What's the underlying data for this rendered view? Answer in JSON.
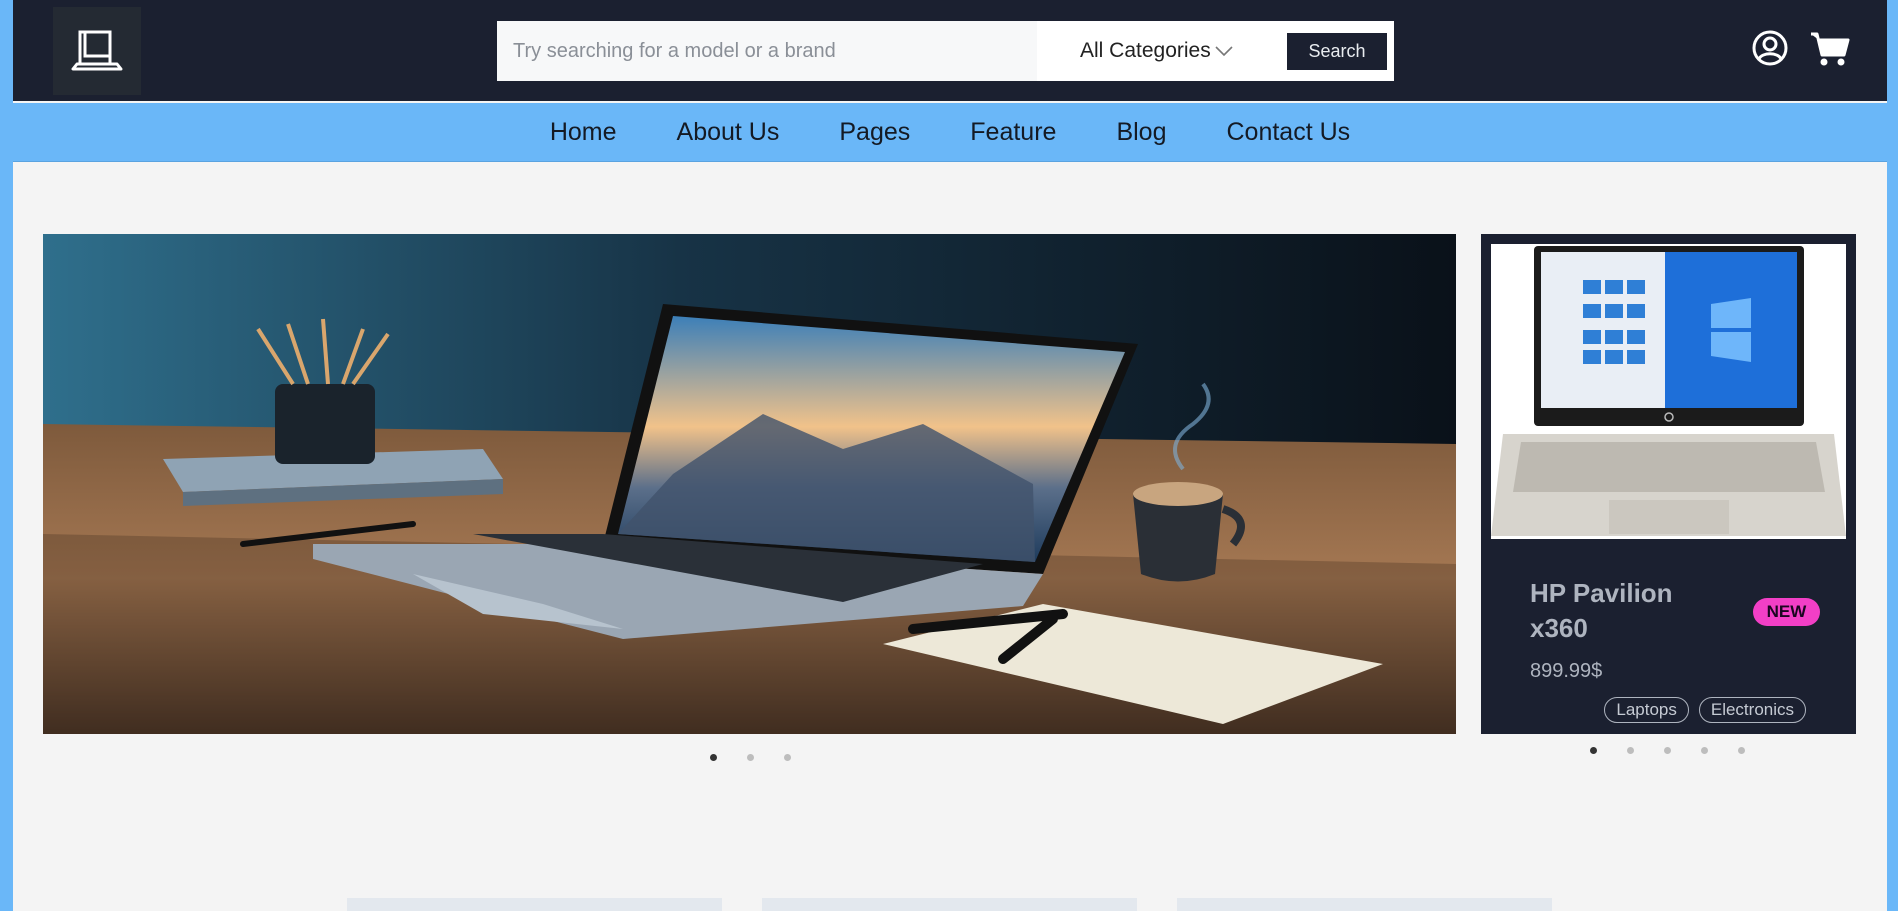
{
  "header": {
    "search_placeholder": "Try searching for a model or a brand",
    "category_selected": "All Categories",
    "search_button": "Search"
  },
  "nav": {
    "items": [
      "Home",
      "About Us",
      "Pages",
      "Feature",
      "Blog",
      "Contact Us"
    ]
  },
  "hero": {
    "slides_total": 3,
    "active_slide": 1
  },
  "product": {
    "name": "HP Pavilion x360",
    "badge": "NEW",
    "price": "899.99$",
    "tags": [
      "Laptops",
      "Electronics"
    ],
    "slides_total": 5,
    "active_slide": 1
  },
  "colors": {
    "header_bg": "#1b2030",
    "nav_bg": "#6ab7f8",
    "badge_bg": "#f23fc6",
    "page_bg": "#f4f4f4"
  },
  "icons": [
    "laptop-logo-icon",
    "chevron-down-icon",
    "user-icon",
    "cart-icon"
  ]
}
